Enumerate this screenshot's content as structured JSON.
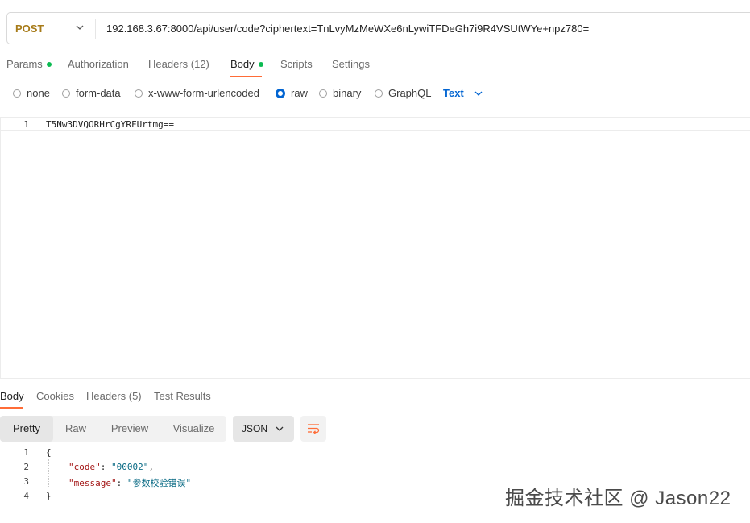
{
  "request": {
    "method": "POST",
    "url": "192.168.3.67:8000/api/user/code?ciphertext=TnLvyMzMeWXe6nLywiTFDeGh7i9R4VSUtWYe+npz780=",
    "tabs": [
      {
        "label": "Params",
        "dot": true
      },
      {
        "label": "Authorization"
      },
      {
        "label": "Headers (12)"
      },
      {
        "label": "Body",
        "dot": true,
        "active": true
      },
      {
        "label": "Scripts"
      },
      {
        "label": "Settings"
      }
    ],
    "body_types": [
      "none",
      "form-data",
      "x-www-form-urlencoded",
      "raw",
      "binary",
      "GraphQL"
    ],
    "selected_body_type": "raw",
    "format": "Text",
    "body_lines": [
      {
        "n": "1",
        "text": "T5Nw3DVQORHrCgYRFUrtmg=="
      }
    ]
  },
  "response": {
    "tabs": [
      "Body",
      "Cookies",
      "Headers (5)",
      "Test Results"
    ],
    "active_tab": "Body",
    "view_modes": [
      "Pretty",
      "Raw",
      "Preview",
      "Visualize"
    ],
    "active_view": "Pretty",
    "format": "JSON",
    "lines": {
      "l1": {
        "n": "1",
        "text": "{"
      },
      "l2": {
        "n": "2",
        "key": "\"code\"",
        "sep": ": ",
        "value": "\"00002\"",
        "end": ","
      },
      "l3": {
        "n": "3",
        "key": "\"message\"",
        "sep": ": ",
        "value": "\"参数校验错误\""
      },
      "l4": {
        "n": "4",
        "text": "}"
      }
    }
  },
  "watermark": "掘金技术社区 @ Jason22",
  "colors": {
    "accent": "#ff6c37",
    "method_post": "#a77b19",
    "dot_green": "#0cbb52",
    "link_blue": "#0265d2"
  },
  "icons": [
    "chevron-down-icon",
    "wrap-lines-icon"
  ]
}
